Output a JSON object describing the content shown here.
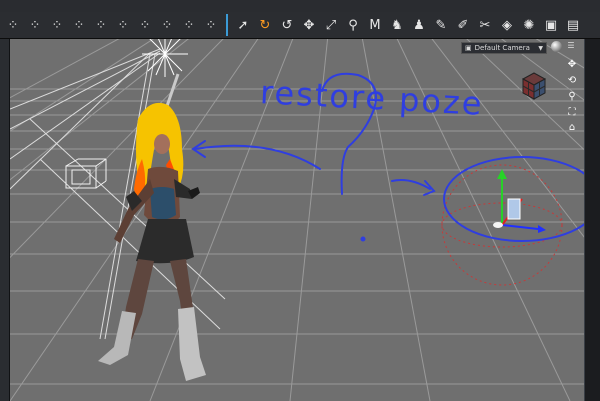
{
  "toolbar": {
    "items": [
      {
        "icon": "nodes-icon"
      },
      {
        "icon": "nodes-icon"
      },
      {
        "icon": "nodes-icon"
      },
      {
        "icon": "nodes-icon"
      },
      {
        "icon": "nodes-icon"
      },
      {
        "icon": "nodes-icon"
      },
      {
        "icon": "nodes-icon"
      },
      {
        "icon": "nodes-icon"
      },
      {
        "icon": "nodes-icon"
      },
      {
        "icon": "nodes-icon"
      },
      {
        "icon": "pointer-icon"
      },
      {
        "icon": "rotate-icon"
      },
      {
        "icon": "rotate-arrow-icon"
      },
      {
        "icon": "move-icon"
      },
      {
        "icon": "scale-icon"
      },
      {
        "icon": "joint-icon"
      },
      {
        "icon": "morph-icon"
      },
      {
        "icon": "figure-icon"
      },
      {
        "icon": "figure-icon"
      },
      {
        "icon": "tool-icon"
      },
      {
        "icon": "tool-icon"
      },
      {
        "icon": "tool-icon"
      },
      {
        "icon": "tool-icon"
      },
      {
        "icon": "light-icon"
      },
      {
        "icon": "camera-icon"
      },
      {
        "icon": "camera-icon"
      }
    ]
  },
  "viewport": {
    "camera_label": "Default Camera",
    "annotation_text": "restore poze",
    "nav_icons": [
      "pan-icon",
      "orbit-icon",
      "zoom-icon",
      "frame-icon",
      "home-icon"
    ]
  },
  "colors": {
    "annotation": "#2f3ee0",
    "accent": "#3b9bd6",
    "viewport_bg": "#6f6f6f",
    "grid_line": "#9a9a9a"
  }
}
